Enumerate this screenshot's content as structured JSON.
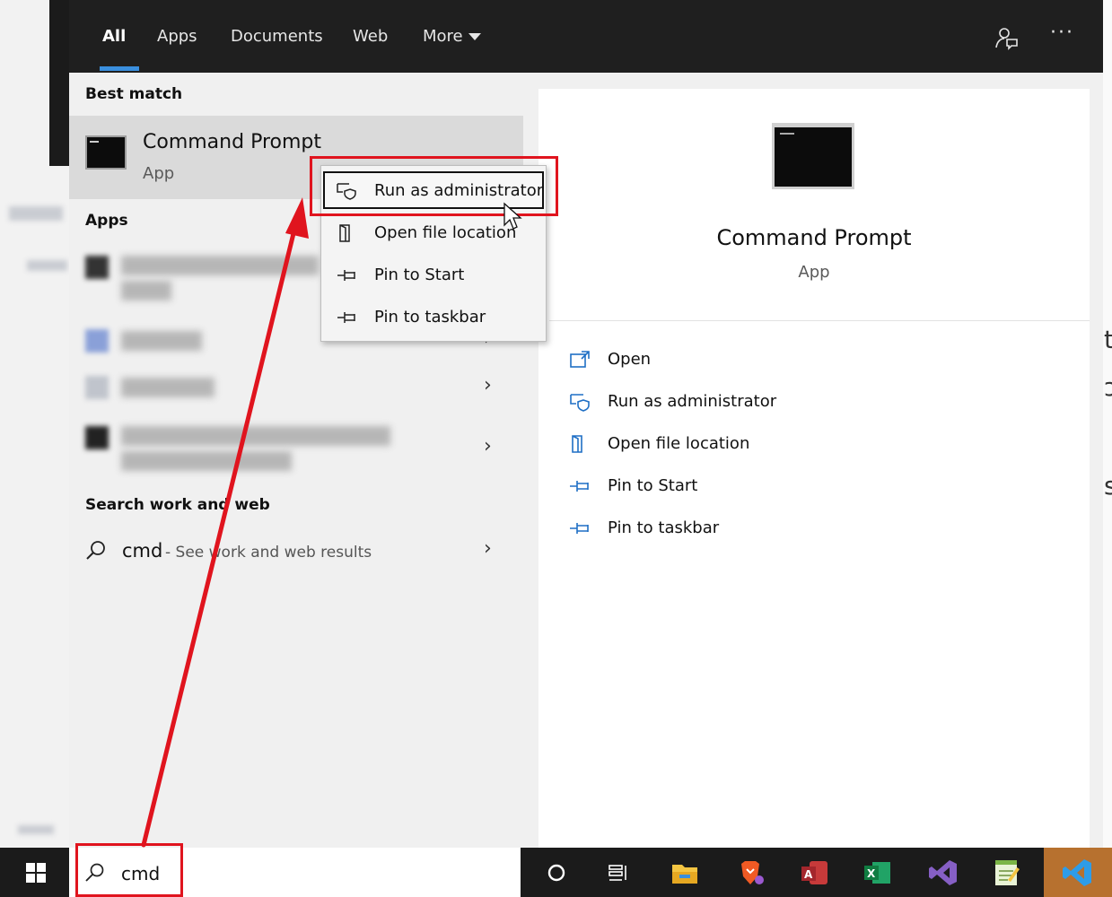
{
  "search": {
    "tabs": [
      {
        "label": "All",
        "active": true
      },
      {
        "label": "Apps"
      },
      {
        "label": "Documents"
      },
      {
        "label": "Web"
      },
      {
        "label": "More"
      }
    ],
    "more_menu_icon": "ellipsis-icon",
    "query": "cmd"
  },
  "left_panel": {
    "best_match_heading": "Best match",
    "best_match": {
      "title": "Command Prompt",
      "subtitle": "App"
    },
    "apps_heading": "Apps",
    "web_heading": "Search work and web",
    "web_result": {
      "query": "cmd",
      "hint": "- See work and web results"
    }
  },
  "context_menu": {
    "items": [
      {
        "label": "Run as administrator",
        "icon": "shield-icon"
      },
      {
        "label": "Open file location",
        "icon": "folder-icon"
      },
      {
        "label": "Pin to Start",
        "icon": "pin-icon"
      },
      {
        "label": "Pin to taskbar",
        "icon": "pin-icon"
      }
    ]
  },
  "preview": {
    "title": "Command Prompt",
    "subtitle": "App",
    "actions": [
      {
        "label": "Open",
        "icon": "open-icon"
      },
      {
        "label": "Run as administrator",
        "icon": "shield-icon"
      },
      {
        "label": "Open file location",
        "icon": "folder-icon"
      },
      {
        "label": "Pin to Start",
        "icon": "pin-icon"
      },
      {
        "label": "Pin to taskbar",
        "icon": "pin-icon"
      }
    ]
  },
  "taskbar": {
    "search_text": "cmd",
    "icons": [
      "cortana-icon",
      "task-view-icon",
      "file-explorer-icon",
      "brave-icon",
      "access-icon",
      "excel-icon",
      "visual-studio-icon",
      "notepad-icon",
      "vscode-icon"
    ]
  },
  "colors": {
    "accent": "#3a8fde",
    "annotation_red": "#e0141e",
    "topbar": "#1f1f1f",
    "taskbar": "#1b1b1b"
  }
}
